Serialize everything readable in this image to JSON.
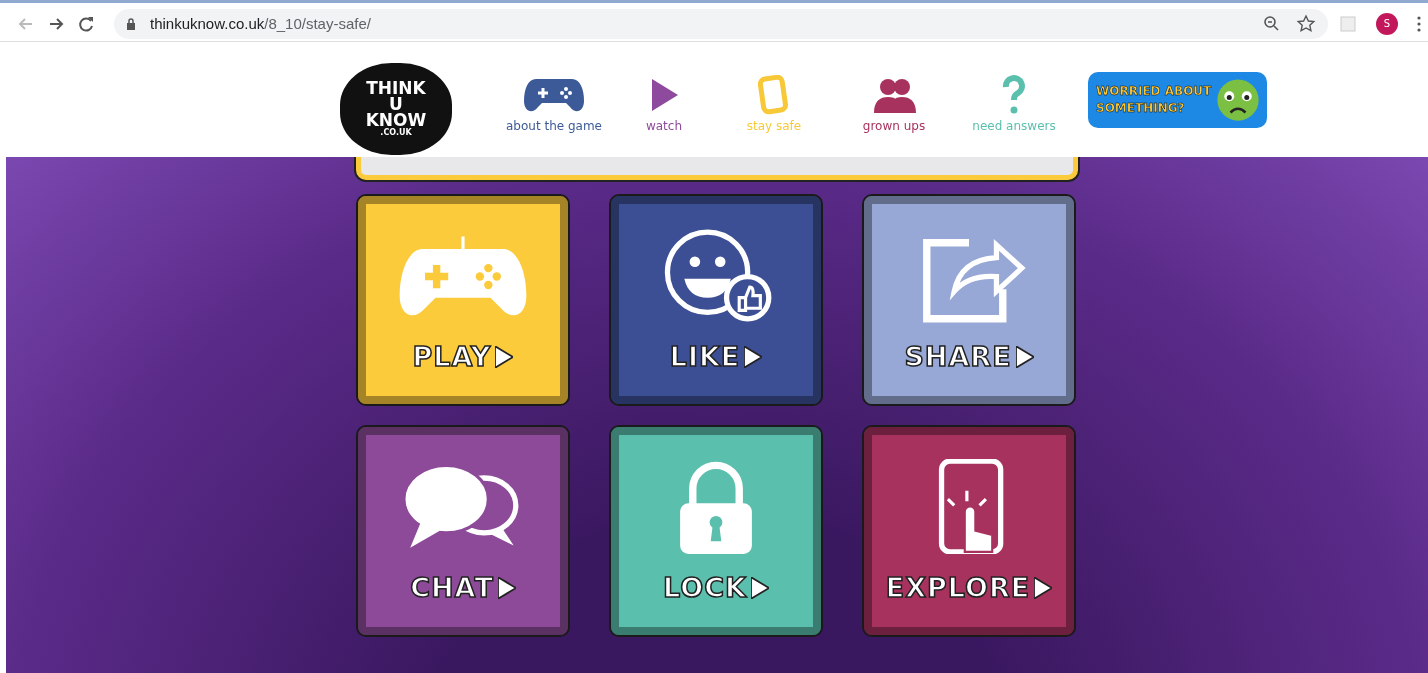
{
  "browser": {
    "url_host": "thinkuknow.co.uk",
    "url_path": "/8_10/stay-safe/",
    "profile_initial": "S"
  },
  "logo": {
    "lines": [
      "THINK",
      "U",
      "KNOW"
    ],
    "suffix": ".CO.UK"
  },
  "nav": [
    {
      "kind": "game",
      "label": "about the game",
      "color": "#3d5a98"
    },
    {
      "kind": "watch",
      "label": "watch",
      "color": "#8e4a9c"
    },
    {
      "kind": "safe",
      "label": "stay safe",
      "color": "#f7c938"
    },
    {
      "kind": "grown",
      "label": "grown ups",
      "color": "#a8325e"
    },
    {
      "kind": "answers",
      "label": "need answers",
      "color": "#5bbfad"
    }
  ],
  "worried": {
    "lines": [
      "WORRIED ABOUT",
      "SOMETHING?"
    ]
  },
  "tiles": [
    {
      "kind": "play",
      "label": "PLAY",
      "color": "#fccb3b"
    },
    {
      "kind": "like",
      "label": "LIKE",
      "color": "#3c4f94"
    },
    {
      "kind": "share",
      "label": "SHARE",
      "color": "#97a7d6"
    },
    {
      "kind": "chat",
      "label": "CHAT",
      "color": "#8c4a99"
    },
    {
      "kind": "lock",
      "label": "LOCK",
      "color": "#5bbfad"
    },
    {
      "kind": "explore",
      "label": "EXPLORE",
      "color": "#a8325e"
    }
  ]
}
